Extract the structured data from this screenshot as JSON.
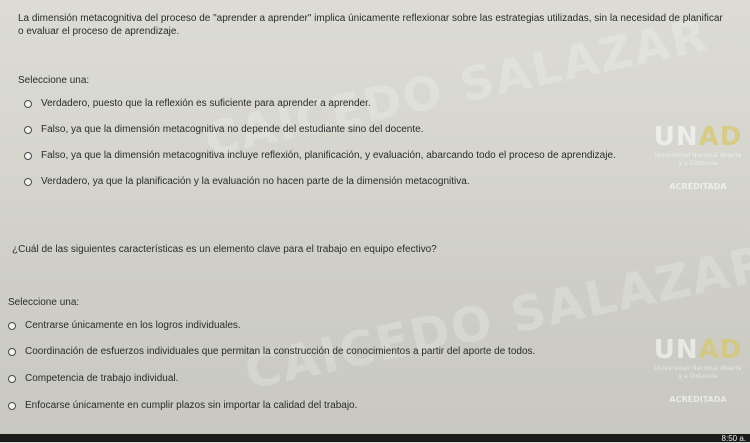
{
  "question1": {
    "text": "La dimensión metacognitiva del proceso de \"aprender a aprender\" implica únicamente reflexionar sobre las estrategias utilizadas, sin la necesidad de planificar o evaluar el proceso de aprendizaje.",
    "prompt": "Seleccione una:",
    "options": [
      "Verdadero, puesto que la reflexión es suficiente para aprender a aprender.",
      "Falso, ya que la dimensión metacognitiva no depende del estudiante sino del docente.",
      "Falso, ya que la dimensión metacognitiva incluye reflexión, planificación, y evaluación, abarcando todo el proceso de aprendizaje.",
      "Verdadero, ya que la planificación y la evaluación no hacen parte de la dimensión metacognitiva."
    ]
  },
  "question2": {
    "text": "¿Cuál de las siguientes características es un elemento clave para el trabajo en equipo efectivo?",
    "prompt": "Seleccione una:",
    "options": [
      "Centrarse únicamente en los logros individuales.",
      "Coordinación de esfuerzos individuales que permitan la construcción de conocimientos a partir del aporte de todos.",
      "Competencia de trabajo individual.",
      "Enfocarse únicamente en cumplir plazos sin importar la calidad del trabajo."
    ]
  },
  "watermark": {
    "text": "CAICEDO SALAZAR"
  },
  "logo": {
    "mark_a": "UN",
    "mark_b": "AD",
    "subtitle": "Universidad Nacional Abierta y a Distancia",
    "accreditation": "ACREDITADA"
  },
  "taskbar": {
    "clock": "8:50 a."
  }
}
